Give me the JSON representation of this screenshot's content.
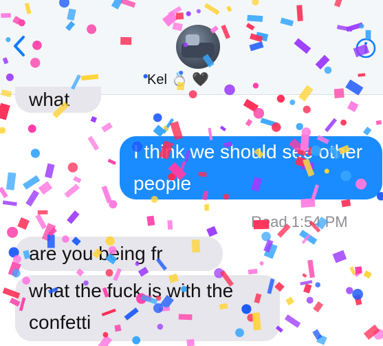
{
  "header": {
    "contact_name": "Kel",
    "back_icon": "chevron-left-icon",
    "info_icon": "info-icon",
    "accent": "#0a7cff"
  },
  "messages": [
    {
      "direction": "received",
      "text": "what"
    },
    {
      "direction": "sent",
      "text": "I think we should see other people"
    },
    {
      "direction": "received",
      "text": "are you being fr"
    },
    {
      "direction": "received",
      "text": "what the fuck is with the confetti"
    }
  ],
  "read_receipt": "Read 1:54 PM",
  "colors": {
    "sent_bubble": "#1b8cff",
    "received_bubble": "#e6e6ec",
    "confetti": [
      "#ff3da8",
      "#3aa7ff",
      "#ffd43b",
      "#9c3dff",
      "#ff2d55",
      "#1e5bff",
      "#ff7ae0"
    ]
  }
}
